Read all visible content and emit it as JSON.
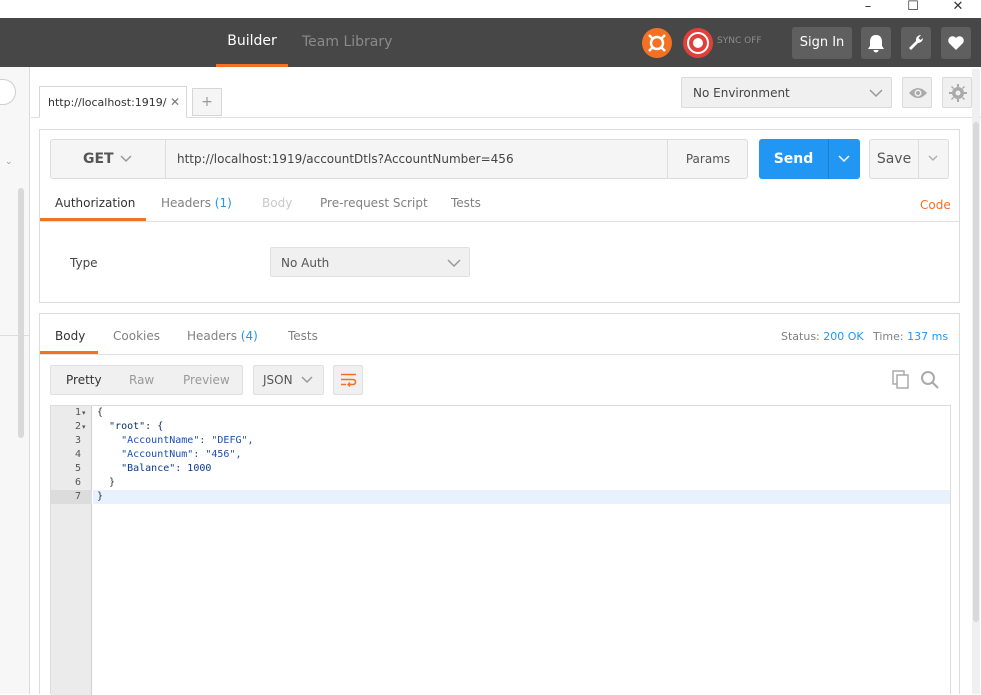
{
  "window": {
    "minimize": "–",
    "maximize": "☐",
    "close": "✕"
  },
  "header": {
    "tabs": [
      {
        "label": "Builder",
        "active": true
      },
      {
        "label": "Team Library",
        "active": false
      }
    ],
    "sync_label": "SYNC OFF",
    "sign_in": "Sign In",
    "accent": "#f47023"
  },
  "request_tab": {
    "label": "http://localhost:1919/",
    "close": "✕",
    "new_tab": "+"
  },
  "environment": {
    "selected": "No Environment"
  },
  "request": {
    "method": "GET",
    "url": "http://localhost:1919/accountDtls?AccountNumber=456",
    "params_label": "Params",
    "send_label": "Send",
    "save_label": "Save",
    "send_color": "#2196f3",
    "tabs": {
      "authorization": "Authorization",
      "headers": "Headers",
      "headers_count": "(1)",
      "body": "Body",
      "prerequest": "Pre-request Script",
      "tests": "Tests"
    },
    "code_link": "Code",
    "auth": {
      "type_label": "Type",
      "type_value": "No Auth"
    }
  },
  "response": {
    "tabs": {
      "body": "Body",
      "cookies": "Cookies",
      "headers": "Headers",
      "headers_count": "(4)",
      "tests": "Tests"
    },
    "status_label": "Status:",
    "status_value": "200 OK",
    "time_label": "Time:",
    "time_value": "137 ms",
    "formats": {
      "pretty": "Pretty",
      "raw": "Raw",
      "preview": "Preview"
    },
    "language": "JSON",
    "code_lines": [
      {
        "num": "1",
        "fold": "▾",
        "text": "{"
      },
      {
        "num": "2",
        "fold": "▾",
        "text": "  \"root\": {"
      },
      {
        "num": "3",
        "fold": "",
        "text": "    \"AccountName\": \"DEFG\","
      },
      {
        "num": "4",
        "fold": "",
        "text": "    \"AccountNum\": \"456\","
      },
      {
        "num": "5",
        "fold": "",
        "text": "    \"Balance\": 1000"
      },
      {
        "num": "6",
        "fold": "",
        "text": "  }"
      },
      {
        "num": "7",
        "fold": "",
        "text": "}"
      }
    ]
  }
}
